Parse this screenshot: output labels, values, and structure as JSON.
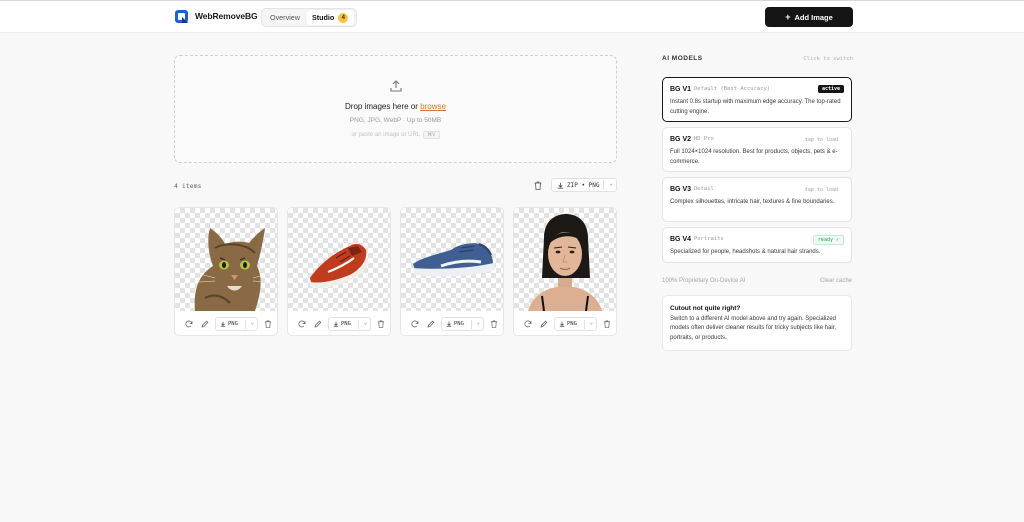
{
  "header": {
    "brand": "WebRemoveBG",
    "tabs": [
      {
        "label": "Overview"
      },
      {
        "label": "Studio",
        "badge": "4"
      }
    ],
    "add_button": "Add Image",
    "add_icon": "plus-icon"
  },
  "dropzone": {
    "title_prefix": "Drop images here or ",
    "browse": "browse",
    "formats": "PNG, JPG, WebP · Up to 50MB",
    "url_hint": "or paste an image or URL",
    "url_key": "⌘V"
  },
  "toolbar": {
    "count": "4 items",
    "export": "ZIP • PNG"
  },
  "cards": [
    {
      "subject": "cat",
      "format": "PNG"
    },
    {
      "subject": "red-sneaker",
      "format": "PNG"
    },
    {
      "subject": "blue-sneaker",
      "format": "PNG"
    },
    {
      "subject": "woman-portrait",
      "format": "PNG"
    }
  ],
  "sidebar": {
    "title": "AI MODELS",
    "hint": "Click to switch",
    "models": [
      {
        "name": "BG V1",
        "tag": "Default (Best Accuracy)",
        "badge": "active",
        "desc": "Instant 0.8s startup with maximum edge accuracy. The top-rated cutting engine."
      },
      {
        "name": "BG V2",
        "tag": "HD Pro",
        "badge": "tap to load",
        "desc": "Full 1024×1024 resolution. Best for products, objects, pets & e-commerce."
      },
      {
        "name": "BG V3",
        "tag": "Detail",
        "badge": "tap to load",
        "desc": "Complex silhouettes, intricate hair, textures & fine boundaries."
      },
      {
        "name": "BG V4",
        "tag": "Portraits",
        "badge": "ready ✓",
        "desc": "Specialized for people, headshots & natural hair strands."
      }
    ],
    "local_note": "100% Proprietary On-Device AI",
    "clear_cache": "Clear cache",
    "tip_title": "Cutout not quite right?",
    "tip_body": "Switch to a different AI model above and try again. Specialized models often deliver cleaner results for tricky subjects like hair, portraits, or products."
  },
  "colors": {
    "accent_link": "#d9772c",
    "primary_button": "#141414",
    "ready_green": "#2e9a58"
  }
}
